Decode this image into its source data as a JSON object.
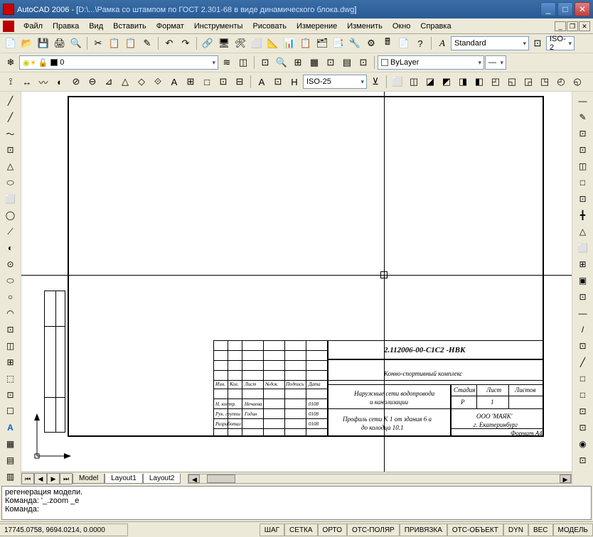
{
  "title": {
    "app": "AutoCAD 2006",
    "sep": " - [",
    "path": "D:\\...\\Рамка со штампом по ГОСТ 2.301-68 в виде динамического блока.dwg",
    "end": "]"
  },
  "menu": [
    "Файл",
    "Правка",
    "Вид",
    "Вставить",
    "Формат",
    "Инструменты",
    "Рисовать",
    "Измерение",
    "Изменить",
    "Окно",
    "Справка"
  ],
  "toolbar1_icons": [
    "📄",
    "📂",
    "💾",
    "🖨",
    "🔍",
    "✂",
    "📋",
    "📋",
    "✎",
    "↶",
    "↷",
    "🔗",
    "🖥",
    "🛠",
    "⬜",
    "📐",
    "📊",
    "📋",
    "🗂",
    "📑",
    "🔧",
    "⚙",
    "🖩",
    "📄",
    "?"
  ],
  "layer_combo": "0",
  "linetype": "ByLayer",
  "style_combo": "Standard",
  "iso_combo2": "ISO-2",
  "dim_icons": [
    "⟟",
    "↔",
    "〰",
    "◐",
    "⊘",
    "⊖",
    "⊿",
    "△",
    "◇",
    "⟐",
    "A",
    "⊞",
    "□",
    "⊡",
    "⊟"
  ],
  "dimstyle": "ISO-25",
  "view_icons": [
    "⬜",
    "◫",
    "◪",
    "◩",
    "◨",
    "◧",
    "◰",
    "◱",
    "◲",
    "◳",
    "◴",
    "◵"
  ],
  "vtb_left": [
    "╱",
    "╱",
    "〜",
    "⊡",
    "△",
    "⬭",
    "⬜",
    "◯",
    "⟋",
    "◐",
    "⊙",
    "⬭",
    "○",
    "◠",
    "⊡",
    "◫",
    "⊞",
    "⬚",
    "⊡",
    "☐",
    "A",
    "▦",
    "▤",
    "▥"
  ],
  "vtb_right": [
    "—",
    "✎",
    "⊡",
    "⊡",
    "◫",
    "□",
    "⊡",
    "╋",
    "△",
    "⬜",
    "⊞",
    "▣",
    "⊡",
    "—",
    "/",
    "⊡",
    "╱",
    "□",
    "□",
    "⊡",
    "⊡",
    "◉",
    "⊡"
  ],
  "stamp": {
    "doc_number": "2.112006-00-С1С2 -НВК",
    "project": "Конно-спортивный комплекс",
    "subtitle1": "Наружные сети водопровода",
    "subtitle2": "и канализации",
    "subtitle3": "Профиль сети К 1 от здания 6 а",
    "subtitle4": "до колодца 10.1",
    "col_stadiya": "Стадия",
    "col_list": "Лист",
    "col_listov": "Листов",
    "val_stadiya": "Р",
    "val_list": "1",
    "company1": "ООО 'МАЯК'",
    "company2": "г. Екатеринбург",
    "format": "Формат А4",
    "row_h1": "Изм.",
    "row_h2": "Кол.",
    "row_h3": "Лист",
    "row_h4": "№док.",
    "row_h5": "Подпись",
    "row_h6": "Дата",
    "r1a": "Н. контр.",
    "r1b": "Нечаева",
    "r1c": "0108",
    "r2a": "Рук. группы",
    "r2b": "Годин",
    "r2c": "0108",
    "r3a": "Разработал",
    "r3b": "",
    "r3c": "0108"
  },
  "tabs": {
    "model": "Model",
    "l1": "Layout1",
    "l2": "Layout2"
  },
  "cmd": {
    "l1": "регенерация модели.",
    "l2": "Команда: '_.zoom _e",
    "prompt": "Команда:"
  },
  "status": {
    "coords": "17745.0758, 9694.0214, 0.0000",
    "segs": [
      "ШАГ",
      "СЕТКА",
      "ОРТО",
      "ОТС-ПОЛЯР",
      "ПРИВЯЗКА",
      "ОТС-ОБЪЕКТ",
      "DYN",
      "ВЕС",
      "МОДЕЛЬ"
    ]
  }
}
